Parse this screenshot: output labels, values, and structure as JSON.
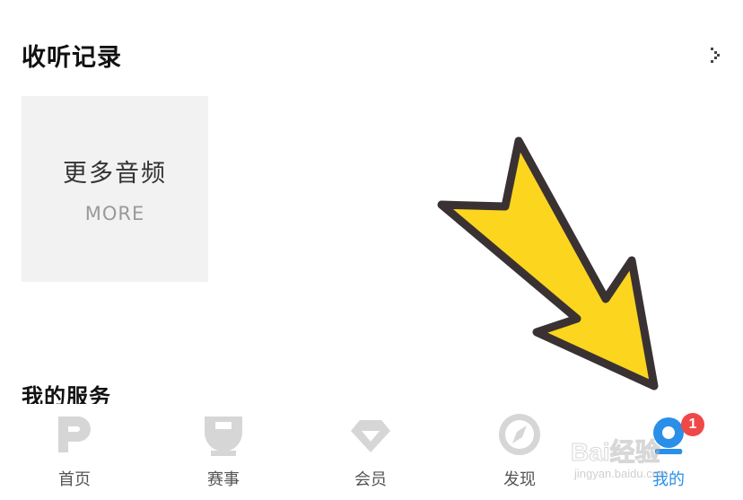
{
  "history": {
    "title": "收听记录",
    "more_card": {
      "title": "更多音频",
      "subtitle": "MORE"
    }
  },
  "services": {
    "title": "我的服务"
  },
  "tabs": [
    {
      "label": "首页",
      "icon": "home-p-icon"
    },
    {
      "label": "赛事",
      "icon": "trophy-icon"
    },
    {
      "label": "会员",
      "icon": "diamond-icon"
    },
    {
      "label": "发现",
      "icon": "compass-icon"
    },
    {
      "label": "我的",
      "icon": "profile-icon",
      "active": true,
      "badge": "1"
    }
  ],
  "watermark": {
    "main": "Bai经验",
    "sub": "jingyan.baidu.com"
  },
  "colors": {
    "accent": "#2a8fe8",
    "badge": "#f04848",
    "icon_gray": "#d6d6d6",
    "arrow_fill": "#fcd51f",
    "arrow_stroke": "#3a3232"
  }
}
